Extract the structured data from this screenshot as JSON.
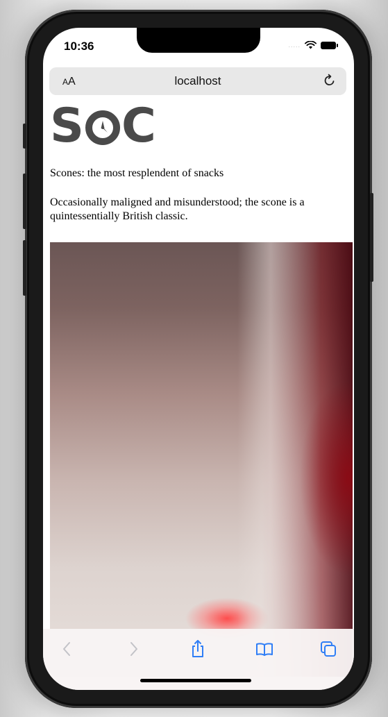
{
  "status_bar": {
    "time": "10:36",
    "signal": "....."
  },
  "url_bar": {
    "text_size_small": "A",
    "text_size_large": "A",
    "url": "localhost",
    "reload_icon": "reload-icon"
  },
  "page": {
    "logo": {
      "letter_1": "S",
      "letter_3": "C",
      "clock_icon": "clock-icon"
    },
    "tagline": "Scones: the most resplendent of snacks",
    "intro": "Occasionally maligned and misunderstood; the scone is a quintessentially British classic."
  },
  "toolbar": {
    "back_icon": "chevron-left-icon",
    "forward_icon": "chevron-right-icon",
    "share_icon": "share-icon",
    "bookmarks_icon": "book-icon",
    "tabs_icon": "tabs-icon"
  },
  "colors": {
    "accent": "#2f7ef6",
    "disabled": "#c2c2c7",
    "logo": "#4a4a4a"
  }
}
